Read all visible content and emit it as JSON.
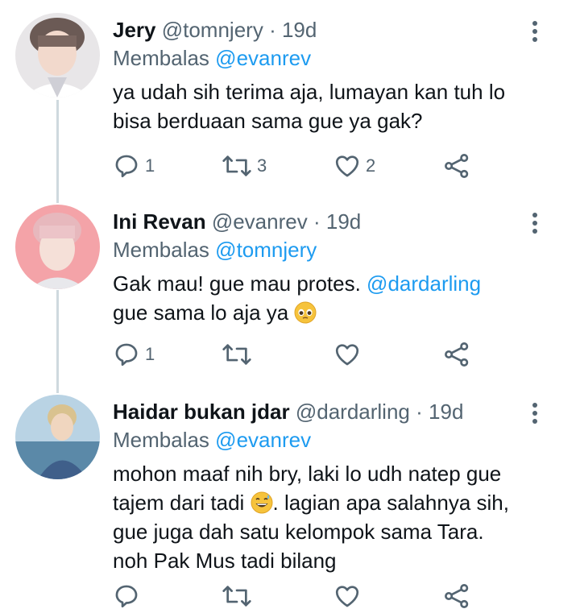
{
  "tweets": [
    {
      "name": "Jery",
      "handle": "@tomnjery",
      "time": "19d",
      "reply_prefix": "Membalas",
      "reply_to": "@evanrev",
      "body_lines": [
        "ya udah sih terima aja, lumayan kan tuh lo",
        "bisa berduaan sama gue ya gak?"
      ],
      "replies": "1",
      "retweets": "3",
      "likes": "2"
    },
    {
      "name": "Ini Revan",
      "handle": "@evanrev",
      "time": "19d",
      "reply_prefix": "Membalas",
      "reply_to": "@tomnjery",
      "body_part1": "Gak mau! gue mau protes. ",
      "body_mention": "@dardarling",
      "body_line2": "gue sama lo aja ya ",
      "replies": "1",
      "retweets": "",
      "likes": ""
    },
    {
      "name": "Haidar bukan jdar",
      "handle": "@dardarling",
      "time": "19d",
      "reply_prefix": "Membalas",
      "reply_to": "@evanrev",
      "body_line1": "mohon maaf nih bry, laki lo udh natep gue",
      "body_line2a": "tajem dari tadi ",
      "body_line2b": ". lagian apa salahnya sih,",
      "body_line3": "gue juga dah satu kelompok sama Tara.",
      "body_line4": "noh Pak Mus tadi bilang",
      "replies": "",
      "retweets": "",
      "likes": ""
    }
  ],
  "separator": "·",
  "colors": {
    "mention": "#1d9bf0",
    "secondary": "#536471",
    "thread": "#cfd9de"
  },
  "icons": [
    "reply-icon",
    "retweet-icon",
    "like-icon",
    "share-icon",
    "more-icon"
  ]
}
